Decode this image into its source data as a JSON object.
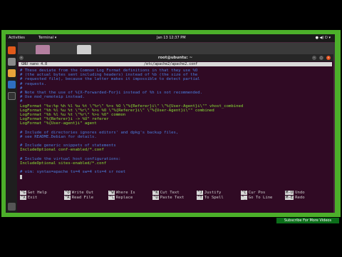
{
  "topbar": {
    "activities": "Activities",
    "app_menu": "Terminal ▾",
    "clock": "Jan 13  12:37 PM",
    "tray": "● ◀) ⏻ ▾"
  },
  "terminal": {
    "title": "root@ubuntu: ~"
  },
  "nano": {
    "version": "GNU nano 4.8",
    "filename": "/etc/apache2/apache2.conf"
  },
  "lines": [
    {
      "t": "# These deviate from the Common Log Format definitions in that they use %O",
      "c": "c"
    },
    {
      "t": "# (the actual bytes sent including headers) instead of %b (the size of the",
      "c": "c"
    },
    {
      "t": "# requested file), because the latter makes it impossible to detect partial",
      "c": "c"
    },
    {
      "t": "# requests.",
      "c": "c"
    },
    {
      "t": "#",
      "c": "c"
    },
    {
      "t": "# Note that the use of %{X-Forwarded-For}i instead of %h is not recommended.",
      "c": "c"
    },
    {
      "t": "# Use mod_remoteip instead.",
      "c": "c"
    },
    {
      "t": "#",
      "c": "c"
    },
    {
      "t": "LogFormat \"%v:%p %h %l %u %t \\\"%r\\\" %>s %O \\\"%{Referer}i\\\" \\\"%{User-Agent}i\\\"\" vhost_combined",
      "c": "g"
    },
    {
      "t": "LogFormat \"%h %l %u %t \\\"%r\\\" %>s %O \\\"%{Referer}i\\\" \\\"%{User-Agent}i\\\"\" combined",
      "c": "g"
    },
    {
      "t": "LogFormat \"%h %l %u %t \\\"%r\\\" %>s %O\" common",
      "c": "g"
    },
    {
      "t": "LogFormat \"%{Referer}i -> %U\" referer",
      "c": "g"
    },
    {
      "t": "LogFormat \"%{User-agent}i\" agent",
      "c": "g"
    },
    {
      "t": "",
      "c": "g"
    },
    {
      "t": "# Include of directories ignores editors' and dpkg's backup files,",
      "c": "c"
    },
    {
      "t": "# see README.Debian for details.",
      "c": "c"
    },
    {
      "t": "",
      "c": "g"
    },
    {
      "t": "# Include generic snippets of statements",
      "c": "c"
    },
    {
      "t": "IncludeOptional conf-enabled/*.conf",
      "c": "g"
    },
    {
      "t": "",
      "c": "g"
    },
    {
      "t": "# Include the virtual host configurations:",
      "c": "c"
    },
    {
      "t": "IncludeOptional sites-enabled/*.conf",
      "c": "g"
    },
    {
      "t": "",
      "c": "g"
    },
    {
      "t": "# vim: syntax=apache ts=4 sw=4 sts=4 sr noet",
      "c": "c"
    }
  ],
  "shortcuts_row1": [
    {
      "key": "^G",
      "label": "Get Help"
    },
    {
      "key": "^O",
      "label": "Write Out"
    },
    {
      "key": "^W",
      "label": "Where Is"
    },
    {
      "key": "^K",
      "label": "Cut Text"
    },
    {
      "key": "^J",
      "label": "Justify"
    },
    {
      "key": "^C",
      "label": "Cur Pos"
    },
    {
      "key": "M-U",
      "label": "Undo"
    }
  ],
  "shortcuts_row2": [
    {
      "key": "^X",
      "label": "Exit"
    },
    {
      "key": "^R",
      "label": "Read File"
    },
    {
      "key": "^\\",
      "label": "Replace"
    },
    {
      "key": "^U",
      "label": "Paste Text"
    },
    {
      "key": "^T",
      "label": "To Spell"
    },
    {
      "key": "^_",
      "label": "Go To Line"
    },
    {
      "key": "M-E",
      "label": "Redo"
    }
  ],
  "overlay": {
    "subscribe": "Subscribe For More Videos"
  },
  "colors": {
    "border_green": "#4caf2a",
    "terminal_bg": "#300a24",
    "comment_blue": "#4a7fe0",
    "directive_green": "#8ae234"
  }
}
